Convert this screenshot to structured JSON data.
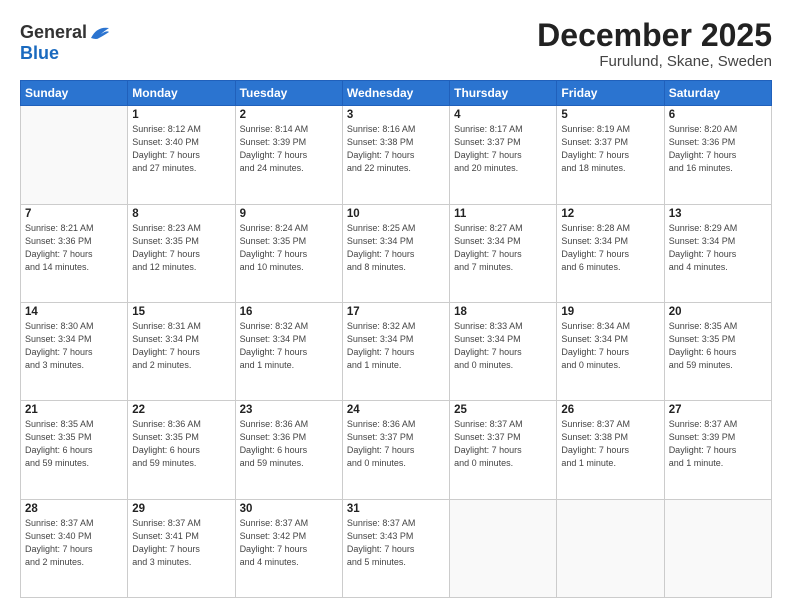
{
  "logo": {
    "general": "General",
    "blue": "Blue"
  },
  "header": {
    "month": "December 2025",
    "location": "Furulund, Skane, Sweden"
  },
  "weekdays": [
    "Sunday",
    "Monday",
    "Tuesday",
    "Wednesday",
    "Thursday",
    "Friday",
    "Saturday"
  ],
  "weeks": [
    [
      {
        "day": "",
        "info": ""
      },
      {
        "day": "1",
        "info": "Sunrise: 8:12 AM\nSunset: 3:40 PM\nDaylight: 7 hours\nand 27 minutes."
      },
      {
        "day": "2",
        "info": "Sunrise: 8:14 AM\nSunset: 3:39 PM\nDaylight: 7 hours\nand 24 minutes."
      },
      {
        "day": "3",
        "info": "Sunrise: 8:16 AM\nSunset: 3:38 PM\nDaylight: 7 hours\nand 22 minutes."
      },
      {
        "day": "4",
        "info": "Sunrise: 8:17 AM\nSunset: 3:37 PM\nDaylight: 7 hours\nand 20 minutes."
      },
      {
        "day": "5",
        "info": "Sunrise: 8:19 AM\nSunset: 3:37 PM\nDaylight: 7 hours\nand 18 minutes."
      },
      {
        "day": "6",
        "info": "Sunrise: 8:20 AM\nSunset: 3:36 PM\nDaylight: 7 hours\nand 16 minutes."
      }
    ],
    [
      {
        "day": "7",
        "info": "Sunrise: 8:21 AM\nSunset: 3:36 PM\nDaylight: 7 hours\nand 14 minutes."
      },
      {
        "day": "8",
        "info": "Sunrise: 8:23 AM\nSunset: 3:35 PM\nDaylight: 7 hours\nand 12 minutes."
      },
      {
        "day": "9",
        "info": "Sunrise: 8:24 AM\nSunset: 3:35 PM\nDaylight: 7 hours\nand 10 minutes."
      },
      {
        "day": "10",
        "info": "Sunrise: 8:25 AM\nSunset: 3:34 PM\nDaylight: 7 hours\nand 8 minutes."
      },
      {
        "day": "11",
        "info": "Sunrise: 8:27 AM\nSunset: 3:34 PM\nDaylight: 7 hours\nand 7 minutes."
      },
      {
        "day": "12",
        "info": "Sunrise: 8:28 AM\nSunset: 3:34 PM\nDaylight: 7 hours\nand 6 minutes."
      },
      {
        "day": "13",
        "info": "Sunrise: 8:29 AM\nSunset: 3:34 PM\nDaylight: 7 hours\nand 4 minutes."
      }
    ],
    [
      {
        "day": "14",
        "info": "Sunrise: 8:30 AM\nSunset: 3:34 PM\nDaylight: 7 hours\nand 3 minutes."
      },
      {
        "day": "15",
        "info": "Sunrise: 8:31 AM\nSunset: 3:34 PM\nDaylight: 7 hours\nand 2 minutes."
      },
      {
        "day": "16",
        "info": "Sunrise: 8:32 AM\nSunset: 3:34 PM\nDaylight: 7 hours\nand 1 minute."
      },
      {
        "day": "17",
        "info": "Sunrise: 8:32 AM\nSunset: 3:34 PM\nDaylight: 7 hours\nand 1 minute."
      },
      {
        "day": "18",
        "info": "Sunrise: 8:33 AM\nSunset: 3:34 PM\nDaylight: 7 hours\nand 0 minutes."
      },
      {
        "day": "19",
        "info": "Sunrise: 8:34 AM\nSunset: 3:34 PM\nDaylight: 7 hours\nand 0 minutes."
      },
      {
        "day": "20",
        "info": "Sunrise: 8:35 AM\nSunset: 3:35 PM\nDaylight: 6 hours\nand 59 minutes."
      }
    ],
    [
      {
        "day": "21",
        "info": "Sunrise: 8:35 AM\nSunset: 3:35 PM\nDaylight: 6 hours\nand 59 minutes."
      },
      {
        "day": "22",
        "info": "Sunrise: 8:36 AM\nSunset: 3:35 PM\nDaylight: 6 hours\nand 59 minutes."
      },
      {
        "day": "23",
        "info": "Sunrise: 8:36 AM\nSunset: 3:36 PM\nDaylight: 6 hours\nand 59 minutes."
      },
      {
        "day": "24",
        "info": "Sunrise: 8:36 AM\nSunset: 3:37 PM\nDaylight: 7 hours\nand 0 minutes."
      },
      {
        "day": "25",
        "info": "Sunrise: 8:37 AM\nSunset: 3:37 PM\nDaylight: 7 hours\nand 0 minutes."
      },
      {
        "day": "26",
        "info": "Sunrise: 8:37 AM\nSunset: 3:38 PM\nDaylight: 7 hours\nand 1 minute."
      },
      {
        "day": "27",
        "info": "Sunrise: 8:37 AM\nSunset: 3:39 PM\nDaylight: 7 hours\nand 1 minute."
      }
    ],
    [
      {
        "day": "28",
        "info": "Sunrise: 8:37 AM\nSunset: 3:40 PM\nDaylight: 7 hours\nand 2 minutes."
      },
      {
        "day": "29",
        "info": "Sunrise: 8:37 AM\nSunset: 3:41 PM\nDaylight: 7 hours\nand 3 minutes."
      },
      {
        "day": "30",
        "info": "Sunrise: 8:37 AM\nSunset: 3:42 PM\nDaylight: 7 hours\nand 4 minutes."
      },
      {
        "day": "31",
        "info": "Sunrise: 8:37 AM\nSunset: 3:43 PM\nDaylight: 7 hours\nand 5 minutes."
      },
      {
        "day": "",
        "info": ""
      },
      {
        "day": "",
        "info": ""
      },
      {
        "day": "",
        "info": ""
      }
    ]
  ]
}
